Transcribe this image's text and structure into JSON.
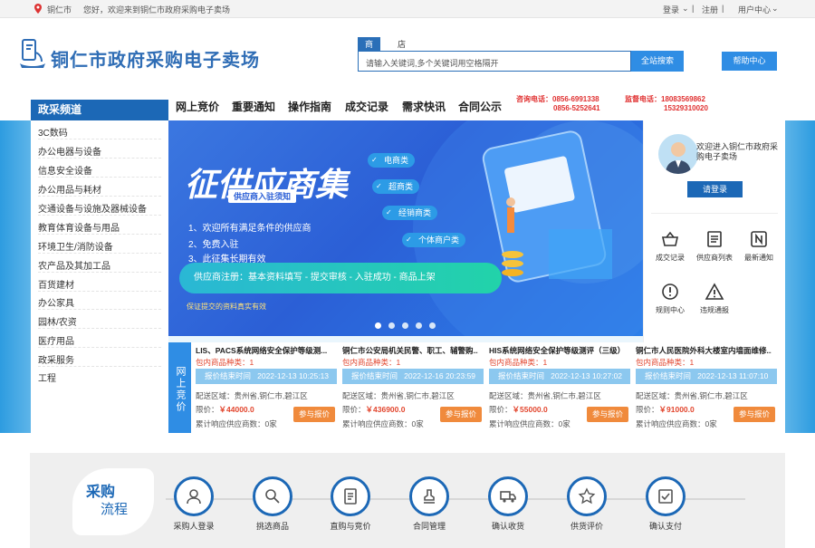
{
  "topbar": {
    "city": "铜仁市",
    "welcome": "您好，欢迎来到铜仁市政府采购电子卖场",
    "login": "登录",
    "register": "注册",
    "user_center": "用户中心"
  },
  "header": {
    "title": "铜仁市政府采购电子卖场",
    "search_tabs": [
      "商品",
      "店铺"
    ],
    "search_placeholder": "请输入关键词,多个关键词用空格隔开",
    "search_button": "全站搜索",
    "help_button": "帮助中心"
  },
  "nav": {
    "channel": "政采频道",
    "items": [
      "网上竞价",
      "重要通知",
      "操作指南",
      "成交记录",
      "需求快讯",
      "合同公示"
    ],
    "consult_label": "咨询电话：0856-6991338",
    "consult_line2": "0856-5252641",
    "supervise_label": "监督电话：18083569862",
    "supervise_line2": "15329310020"
  },
  "sidebar": {
    "items": [
      "3C数码",
      "办公电器与设备",
      "信息安全设备",
      "办公用品与耗材",
      "交通设备与设施及器械设备",
      "教育体育设备与用品",
      "环境卫生/消防设备",
      "农产品及其加工品",
      "百货建材",
      "办公家具",
      "园林/农资",
      "医疗用品",
      "政采服务",
      "工程"
    ]
  },
  "banner": {
    "title": "征供应商集",
    "subtitle": "供应商入驻须知",
    "lines": [
      "1、欢迎所有满足条件的供应商",
      "2、免费入驻",
      "3、此征集长期有效"
    ],
    "tags": [
      "电商类",
      "超商类",
      "经销商类",
      "个体商户类"
    ],
    "pill": "供应商注册：基本资料填写 - 提交审核 - 入驻成功 - 商品上架",
    "note": "保证提交的资料真实有效"
  },
  "right": {
    "welcome": "欢迎进入铜仁市政府采购电子卖场",
    "login_button": "请登录",
    "links": [
      "成交记录",
      "供应商列表",
      "最新通知",
      "规则中心",
      "违规通报"
    ]
  },
  "auction": {
    "tag": "网上竞价",
    "pack_label": "包内商品种类：1",
    "end_label": "报价结束时间",
    "area_label": "配送区域：贵州省,铜仁市,碧江区",
    "price_prefix": "限价：",
    "count_label": "累计响应供应商数：0家",
    "btn": "参与报价",
    "cards": [
      {
        "title": "LIS、PACS系统网络安全保护等级测...",
        "time": "2022-12-13 10:25:13",
        "price": "￥44000.0"
      },
      {
        "title": "铜仁市公安局机关民警、职工、辅警购...",
        "time": "2022-12-16 20:23:59",
        "price": "￥436900.0"
      },
      {
        "title": "HIS系统网络安全保护等级测评（三级）",
        "time": "2022-12-13 10:27:02",
        "price": "￥55000.0"
      },
      {
        "title": "铜仁市人民医院外科大楼室内墙面维修...",
        "time": "2022-12-13 11:07:10",
        "price": "￥91000.0"
      }
    ]
  },
  "process": {
    "title_1": "采购",
    "title_2": "流程",
    "steps": [
      "采购人登录",
      "挑选商品",
      "直购与竞价",
      "合同管理",
      "确认收货",
      "供货评价",
      "确认支付"
    ]
  },
  "colors": {
    "primary": "#1c68b6",
    "accent": "#2f8de4",
    "red": "#e03030",
    "orange": "#f08a3c"
  }
}
